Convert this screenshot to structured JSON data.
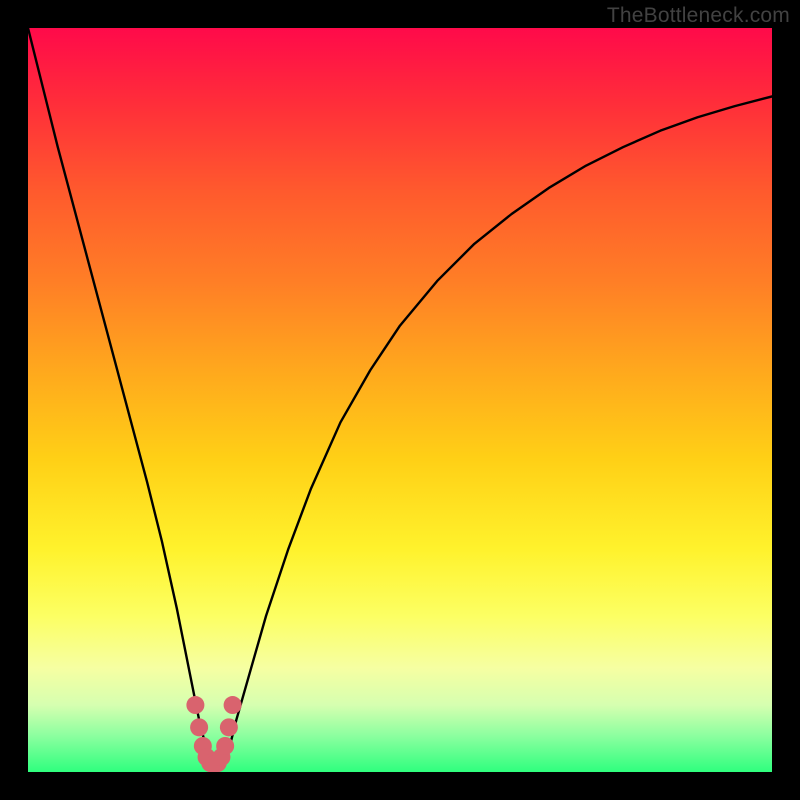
{
  "watermark": "TheBottleneck.com",
  "chart_data": {
    "type": "line",
    "title": "",
    "xlabel": "",
    "ylabel": "",
    "xlim": [
      0,
      100
    ],
    "ylim": [
      0,
      100
    ],
    "curve_color": "#000000",
    "marker_color": "#d9636e",
    "series": [
      {
        "name": "bottleneck-curve",
        "x": [
          0,
          2,
          4,
          6,
          8,
          10,
          12,
          14,
          16,
          18,
          20,
          21,
          22,
          23,
          24,
          25,
          26,
          27,
          28,
          30,
          32,
          35,
          38,
          42,
          46,
          50,
          55,
          60,
          65,
          70,
          75,
          80,
          85,
          90,
          95,
          100
        ],
        "y": [
          100,
          92,
          84,
          76.5,
          69,
          61.5,
          54,
          46.5,
          39,
          31,
          22,
          17,
          12,
          7,
          3,
          1,
          1,
          3,
          7,
          14,
          21,
          30,
          38,
          47,
          54,
          60,
          66,
          71,
          75,
          78.5,
          81.5,
          84,
          86.2,
          88,
          89.5,
          90.8
        ]
      }
    ],
    "markers": {
      "name": "bottleneck-region",
      "x": [
        22.5,
        23,
        23.5,
        24,
        24.5,
        25,
        25.5,
        26,
        26.5,
        27,
        27.5
      ],
      "y": [
        9,
        6,
        3.5,
        2,
        1.2,
        1,
        1.2,
        2,
        3.5,
        6,
        9
      ]
    }
  }
}
